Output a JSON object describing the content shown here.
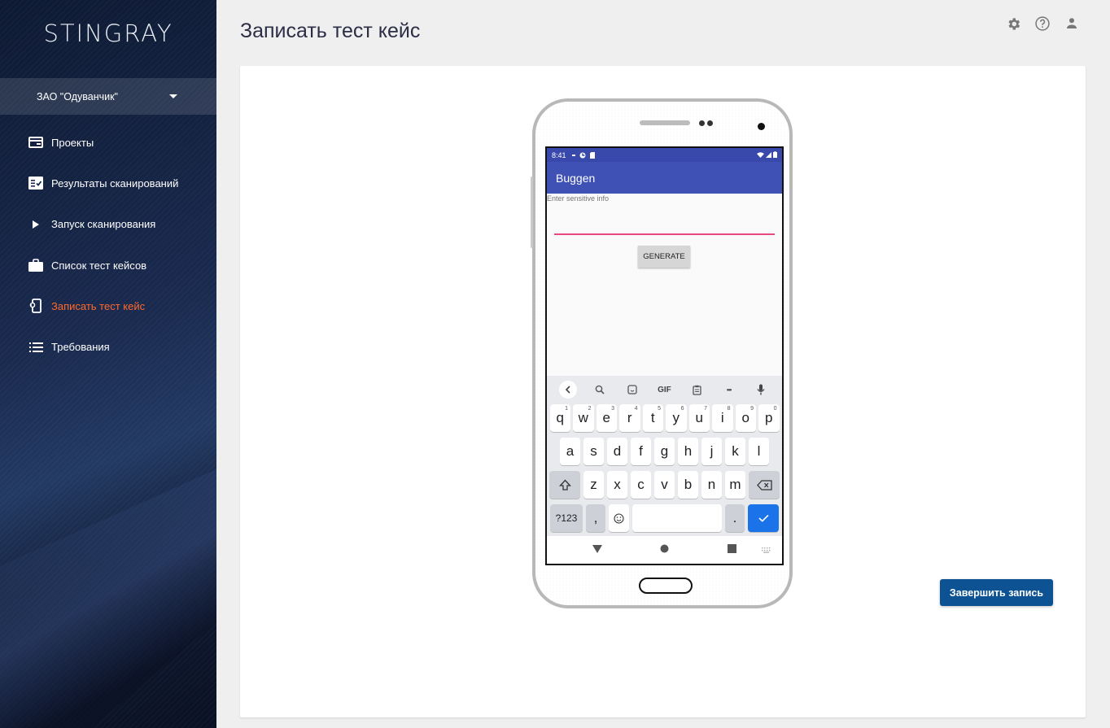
{
  "sidebar": {
    "logo": "STINGRAY",
    "org": "ЗАО \"Одуванчик\"",
    "items": [
      {
        "label": "Проекты",
        "icon": "projects-icon"
      },
      {
        "label": "Результаты сканирований",
        "icon": "scan-results-icon"
      },
      {
        "label": "Запуск сканирования",
        "icon": "play-icon"
      },
      {
        "label": "Список тест кейсов",
        "icon": "briefcase-icon"
      },
      {
        "label": "Записать тест кейс",
        "icon": "record-phone-icon",
        "active": true
      },
      {
        "label": "Требования",
        "icon": "list-icon"
      }
    ]
  },
  "header": {
    "title": "Записать тест кейс",
    "icons": [
      "settings-icon",
      "help-icon",
      "account-icon"
    ]
  },
  "main": {
    "finish_button": "Завершить запись"
  },
  "device": {
    "status_time": "8:41",
    "app_title": "Buggen",
    "input_hint": "Enter sensitive info",
    "generate_button": "GENERATE",
    "keyboard": {
      "toolbar": [
        "back",
        "search",
        "sticker",
        "GIF",
        "clipboard",
        "more",
        "mic"
      ],
      "gif_label": "GIF",
      "more_label": "•••",
      "row1": [
        {
          "k": "q",
          "n": "1"
        },
        {
          "k": "w",
          "n": "2"
        },
        {
          "k": "e",
          "n": "3"
        },
        {
          "k": "r",
          "n": "4"
        },
        {
          "k": "t",
          "n": "5"
        },
        {
          "k": "y",
          "n": "6"
        },
        {
          "k": "u",
          "n": "7"
        },
        {
          "k": "i",
          "n": "8"
        },
        {
          "k": "o",
          "n": "9"
        },
        {
          "k": "p",
          "n": "0"
        }
      ],
      "row2": [
        "a",
        "s",
        "d",
        "f",
        "g",
        "h",
        "j",
        "k",
        "l"
      ],
      "row3": [
        "z",
        "x",
        "c",
        "v",
        "b",
        "n",
        "m"
      ],
      "symbols_key": "?123",
      "comma_key": ",",
      "period_key": "."
    }
  },
  "colors": {
    "accent_active": "#ff6a2c",
    "primary_button": "#0d5394",
    "app_bar": "#3f51b5",
    "input_underline": "#e64a7e",
    "keyboard_action": "#1a73e8"
  }
}
